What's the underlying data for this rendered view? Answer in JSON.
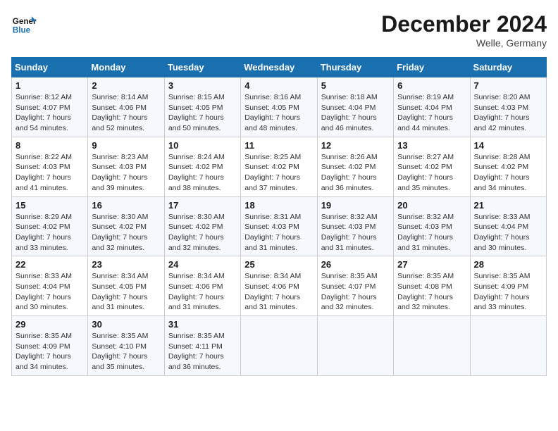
{
  "header": {
    "logo_line1": "General",
    "logo_line2": "Blue",
    "month": "December 2024",
    "location": "Welle, Germany"
  },
  "weekdays": [
    "Sunday",
    "Monday",
    "Tuesday",
    "Wednesday",
    "Thursday",
    "Friday",
    "Saturday"
  ],
  "weeks": [
    [
      {
        "day": "1",
        "sunrise": "Sunrise: 8:12 AM",
        "sunset": "Sunset: 4:07 PM",
        "daylight": "Daylight: 7 hours and 54 minutes."
      },
      {
        "day": "2",
        "sunrise": "Sunrise: 8:14 AM",
        "sunset": "Sunset: 4:06 PM",
        "daylight": "Daylight: 7 hours and 52 minutes."
      },
      {
        "day": "3",
        "sunrise": "Sunrise: 8:15 AM",
        "sunset": "Sunset: 4:05 PM",
        "daylight": "Daylight: 7 hours and 50 minutes."
      },
      {
        "day": "4",
        "sunrise": "Sunrise: 8:16 AM",
        "sunset": "Sunset: 4:05 PM",
        "daylight": "Daylight: 7 hours and 48 minutes."
      },
      {
        "day": "5",
        "sunrise": "Sunrise: 8:18 AM",
        "sunset": "Sunset: 4:04 PM",
        "daylight": "Daylight: 7 hours and 46 minutes."
      },
      {
        "day": "6",
        "sunrise": "Sunrise: 8:19 AM",
        "sunset": "Sunset: 4:04 PM",
        "daylight": "Daylight: 7 hours and 44 minutes."
      },
      {
        "day": "7",
        "sunrise": "Sunrise: 8:20 AM",
        "sunset": "Sunset: 4:03 PM",
        "daylight": "Daylight: 7 hours and 42 minutes."
      }
    ],
    [
      {
        "day": "8",
        "sunrise": "Sunrise: 8:22 AM",
        "sunset": "Sunset: 4:03 PM",
        "daylight": "Daylight: 7 hours and 41 minutes."
      },
      {
        "day": "9",
        "sunrise": "Sunrise: 8:23 AM",
        "sunset": "Sunset: 4:03 PM",
        "daylight": "Daylight: 7 hours and 39 minutes."
      },
      {
        "day": "10",
        "sunrise": "Sunrise: 8:24 AM",
        "sunset": "Sunset: 4:02 PM",
        "daylight": "Daylight: 7 hours and 38 minutes."
      },
      {
        "day": "11",
        "sunrise": "Sunrise: 8:25 AM",
        "sunset": "Sunset: 4:02 PM",
        "daylight": "Daylight: 7 hours and 37 minutes."
      },
      {
        "day": "12",
        "sunrise": "Sunrise: 8:26 AM",
        "sunset": "Sunset: 4:02 PM",
        "daylight": "Daylight: 7 hours and 36 minutes."
      },
      {
        "day": "13",
        "sunrise": "Sunrise: 8:27 AM",
        "sunset": "Sunset: 4:02 PM",
        "daylight": "Daylight: 7 hours and 35 minutes."
      },
      {
        "day": "14",
        "sunrise": "Sunrise: 8:28 AM",
        "sunset": "Sunset: 4:02 PM",
        "daylight": "Daylight: 7 hours and 34 minutes."
      }
    ],
    [
      {
        "day": "15",
        "sunrise": "Sunrise: 8:29 AM",
        "sunset": "Sunset: 4:02 PM",
        "daylight": "Daylight: 7 hours and 33 minutes."
      },
      {
        "day": "16",
        "sunrise": "Sunrise: 8:30 AM",
        "sunset": "Sunset: 4:02 PM",
        "daylight": "Daylight: 7 hours and 32 minutes."
      },
      {
        "day": "17",
        "sunrise": "Sunrise: 8:30 AM",
        "sunset": "Sunset: 4:02 PM",
        "daylight": "Daylight: 7 hours and 32 minutes."
      },
      {
        "day": "18",
        "sunrise": "Sunrise: 8:31 AM",
        "sunset": "Sunset: 4:03 PM",
        "daylight": "Daylight: 7 hours and 31 minutes."
      },
      {
        "day": "19",
        "sunrise": "Sunrise: 8:32 AM",
        "sunset": "Sunset: 4:03 PM",
        "daylight": "Daylight: 7 hours and 31 minutes."
      },
      {
        "day": "20",
        "sunrise": "Sunrise: 8:32 AM",
        "sunset": "Sunset: 4:03 PM",
        "daylight": "Daylight: 7 hours and 31 minutes."
      },
      {
        "day": "21",
        "sunrise": "Sunrise: 8:33 AM",
        "sunset": "Sunset: 4:04 PM",
        "daylight": "Daylight: 7 hours and 30 minutes."
      }
    ],
    [
      {
        "day": "22",
        "sunrise": "Sunrise: 8:33 AM",
        "sunset": "Sunset: 4:04 PM",
        "daylight": "Daylight: 7 hours and 30 minutes."
      },
      {
        "day": "23",
        "sunrise": "Sunrise: 8:34 AM",
        "sunset": "Sunset: 4:05 PM",
        "daylight": "Daylight: 7 hours and 31 minutes."
      },
      {
        "day": "24",
        "sunrise": "Sunrise: 8:34 AM",
        "sunset": "Sunset: 4:06 PM",
        "daylight": "Daylight: 7 hours and 31 minutes."
      },
      {
        "day": "25",
        "sunrise": "Sunrise: 8:34 AM",
        "sunset": "Sunset: 4:06 PM",
        "daylight": "Daylight: 7 hours and 31 minutes."
      },
      {
        "day": "26",
        "sunrise": "Sunrise: 8:35 AM",
        "sunset": "Sunset: 4:07 PM",
        "daylight": "Daylight: 7 hours and 32 minutes."
      },
      {
        "day": "27",
        "sunrise": "Sunrise: 8:35 AM",
        "sunset": "Sunset: 4:08 PM",
        "daylight": "Daylight: 7 hours and 32 minutes."
      },
      {
        "day": "28",
        "sunrise": "Sunrise: 8:35 AM",
        "sunset": "Sunset: 4:09 PM",
        "daylight": "Daylight: 7 hours and 33 minutes."
      }
    ],
    [
      {
        "day": "29",
        "sunrise": "Sunrise: 8:35 AM",
        "sunset": "Sunset: 4:09 PM",
        "daylight": "Daylight: 7 hours and 34 minutes."
      },
      {
        "day": "30",
        "sunrise": "Sunrise: 8:35 AM",
        "sunset": "Sunset: 4:10 PM",
        "daylight": "Daylight: 7 hours and 35 minutes."
      },
      {
        "day": "31",
        "sunrise": "Sunrise: 8:35 AM",
        "sunset": "Sunset: 4:11 PM",
        "daylight": "Daylight: 7 hours and 36 minutes."
      },
      null,
      null,
      null,
      null
    ]
  ]
}
